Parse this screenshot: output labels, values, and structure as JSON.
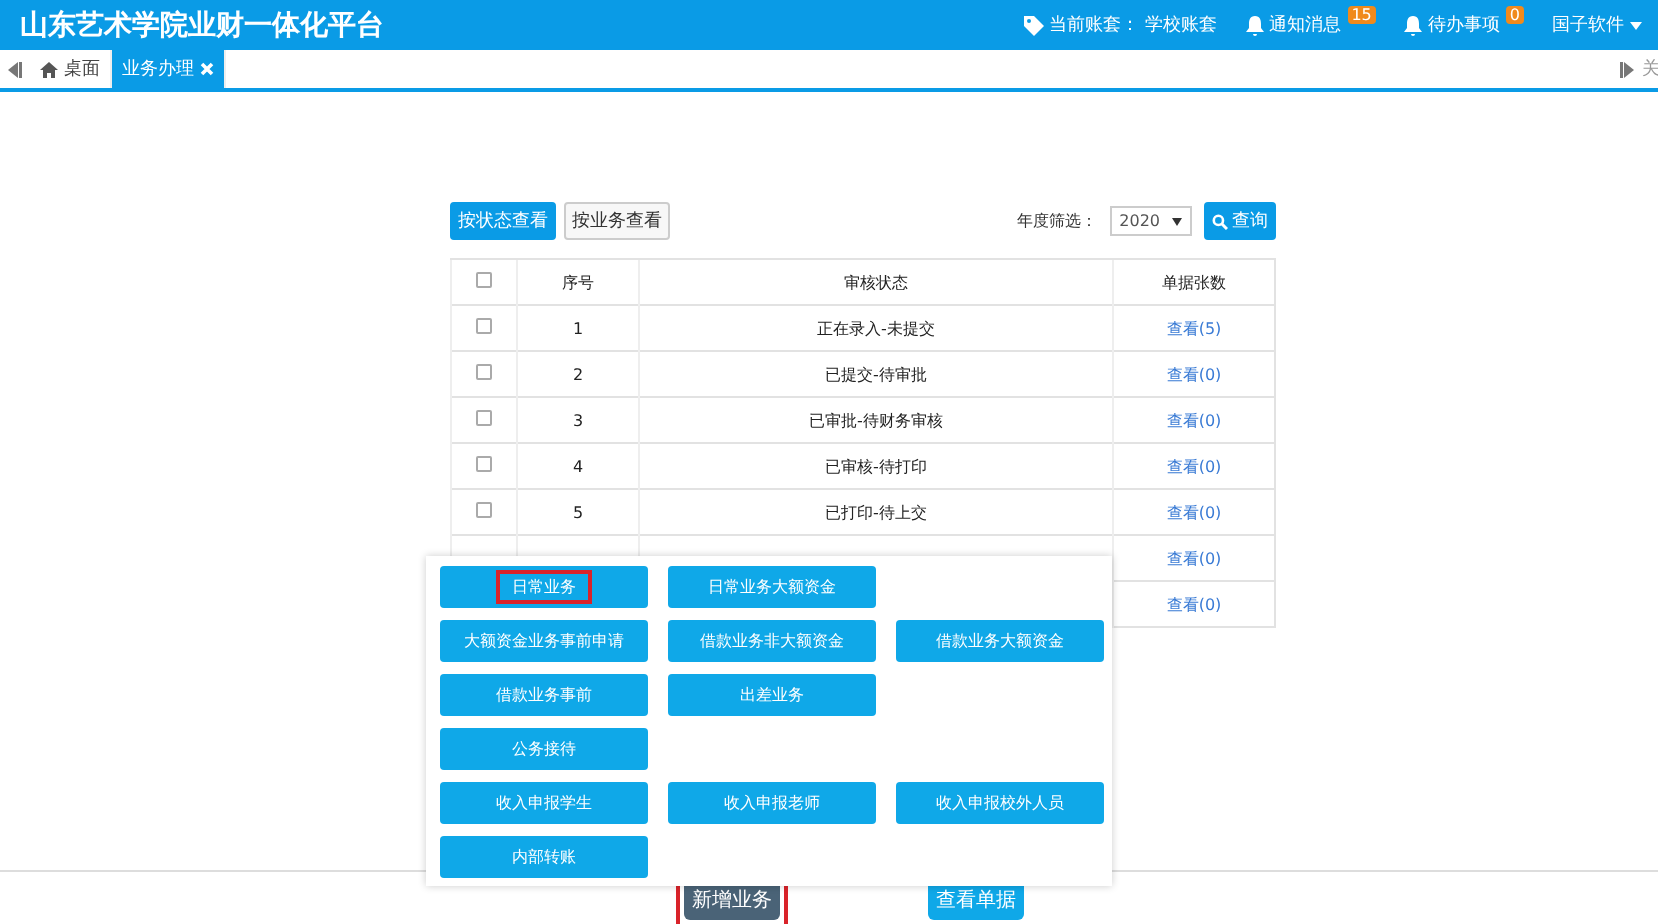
{
  "header": {
    "title": "山东艺术学院业财一体化平台",
    "account_label": "当前账套：",
    "account_value": "学校账套",
    "notice_label": "通知消息",
    "notice_count": "15",
    "todo_label": "待办事项",
    "todo_count": "0",
    "user": "国子软件"
  },
  "tabs": [
    {
      "label": "桌面",
      "kind": "home",
      "selected": false
    },
    {
      "label": "业务办理",
      "kind": "closable",
      "selected": true
    }
  ],
  "tabbar_right": "关",
  "view_buttons": [
    {
      "label": "按状态查看",
      "selected": true
    },
    {
      "label": "按业务查看",
      "selected": false
    }
  ],
  "year_filter": {
    "label": "年度筛选：",
    "value": "2020"
  },
  "query_button": "查询",
  "table": {
    "columns": [
      "序号",
      "审核状态",
      "单据张数"
    ],
    "header_checked": false,
    "rows": [
      {
        "checked": false,
        "index": "1",
        "status": "正在录入-未提交",
        "link": "查看(5)"
      },
      {
        "checked": false,
        "index": "2",
        "status": "已提交-待审批",
        "link": "查看(0)"
      },
      {
        "checked": false,
        "index": "3",
        "status": "已审批-待财务审核",
        "link": "查看(0)"
      },
      {
        "checked": false,
        "index": "4",
        "status": "已审核-待打印",
        "link": "查看(0)"
      },
      {
        "checked": false,
        "index": "5",
        "status": "已打印-待上交",
        "link": "查看(0)"
      },
      {
        "link": "查看(0)"
      },
      {
        "link": "查看(0)"
      }
    ]
  },
  "menu": {
    "rows": [
      [
        {
          "label": "日常业务",
          "selected": true
        },
        {
          "label": "日常业务大额资金",
          "selected": false
        }
      ],
      [
        {
          "label": "大额资金业务事前申请",
          "selected": false
        },
        {
          "label": "借款业务非大额资金",
          "selected": false
        },
        {
          "label": "借款业务大额资金",
          "selected": false
        }
      ],
      [
        {
          "label": "借款业务事前",
          "selected": false
        },
        {
          "label": "出差业务",
          "selected": false
        }
      ],
      [
        {
          "label": "公务接待",
          "selected": false
        }
      ],
      [
        {
          "label": "收入申报学生",
          "selected": false
        },
        {
          "label": "收入申报老师",
          "selected": false
        },
        {
          "label": "收入申报校外人员",
          "selected": false
        }
      ],
      [
        {
          "label": "内部转账",
          "selected": false
        }
      ]
    ]
  },
  "footer_buttons": [
    {
      "label": "新增业务",
      "selected": true
    },
    {
      "label": "查看单据",
      "selected": false
    }
  ]
}
